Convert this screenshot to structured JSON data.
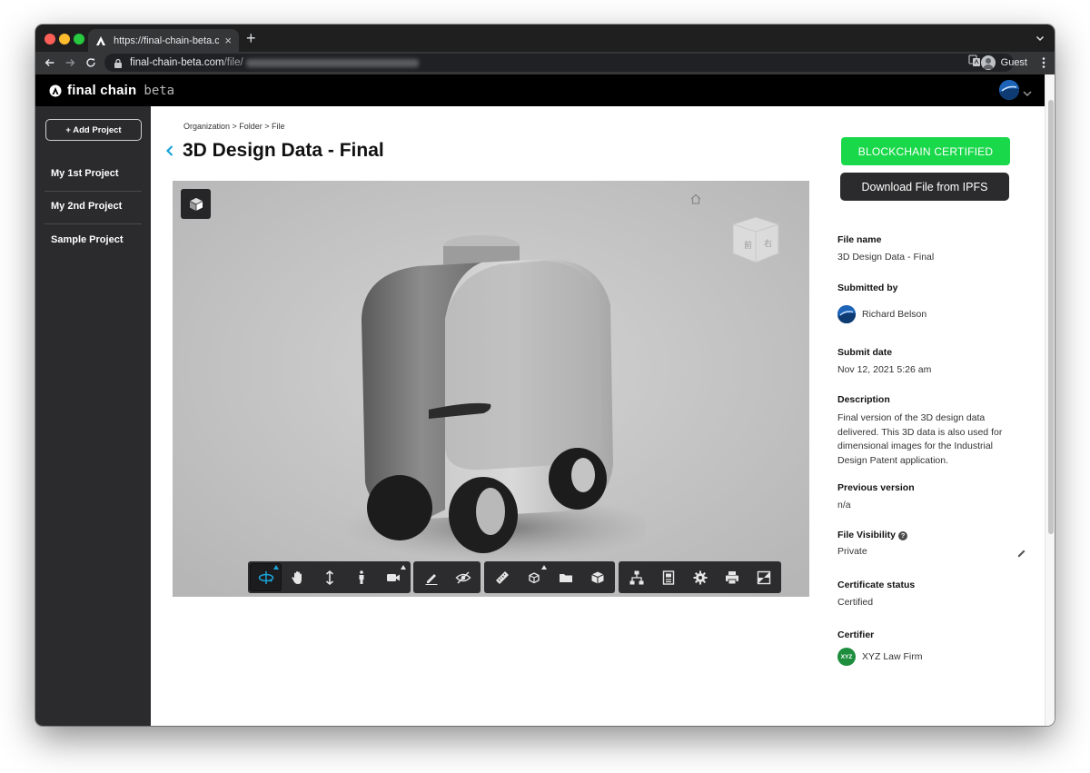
{
  "browser": {
    "tab_title": "https://final-chain-beta.com/fil",
    "url_host": "final-chain-beta.com",
    "url_path": "/file/",
    "profile_label": "Guest"
  },
  "app": {
    "logo": "final chain",
    "logo_suffix": "beta"
  },
  "sidebar": {
    "add_button": "+ Add Project",
    "items": [
      {
        "label": "My 1st Project"
      },
      {
        "label": "My 2nd Project"
      },
      {
        "label": "Sample Project"
      }
    ]
  },
  "main": {
    "breadcrumb": "Organization > Folder > File",
    "title": "3D Design Data - Final"
  },
  "viewer": {
    "viewcube_faces": [
      "前",
      "右"
    ],
    "toolbar_groups": [
      [
        "orbit-icon",
        "pan-icon",
        "zoom-icon",
        "first-person-icon",
        "camera-icon"
      ],
      [
        "markup-icon",
        "hide-icon"
      ],
      [
        "measure-icon",
        "explode-icon",
        "model-browser-icon",
        "properties-cube-icon"
      ],
      [
        "structure-icon",
        "document-icon",
        "settings-icon",
        "print-icon",
        "fullscreen-icon"
      ]
    ]
  },
  "panel": {
    "cert_button": "BLOCKCHAIN CERTIFIED",
    "download_button": "Download File from IPFS",
    "file_name_label": "File name",
    "file_name": "3D Design Data - Final",
    "submitted_by_label": "Submitted by",
    "submitted_by": "Richard Belson",
    "submit_date_label": "Submit date",
    "submit_date": "Nov 12, 2021 5:26 am",
    "description_label": "Description",
    "description": "Final version of the 3D design data delivered. This 3D data is also used for dimensional images for the Industrial Design Patent application.",
    "previous_version_label": "Previous version",
    "previous_version": "n/a",
    "visibility_label": "File Visibility",
    "visibility": "Private",
    "certificate_status_label": "Certificate status",
    "certificate_status": "Certified",
    "certifier_label": "Certifier",
    "certifier": "XYZ Law Firm",
    "certifier_badge": "XYZ"
  },
  "colors": {
    "accent_cyan": "#1aa4d9",
    "certified_green": "#19d84a",
    "sidebar_bg": "#2b2b2d",
    "header_bg": "#000000"
  }
}
